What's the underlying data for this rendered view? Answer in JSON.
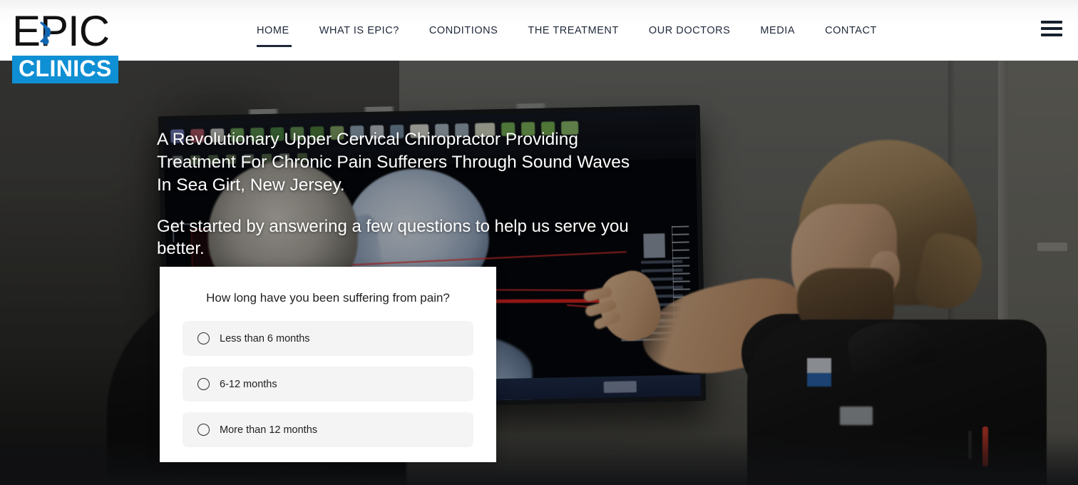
{
  "brand": {
    "name_top": "EPIC",
    "name_bottom": "CLINICS",
    "accent_blue": "#0f8fd4",
    "nav_color": "#1e2838"
  },
  "header": {
    "nav": [
      {
        "label": "HOME",
        "active": true
      },
      {
        "label": "WHAT IS EPIC?",
        "active": false
      },
      {
        "label": "CONDITIONS",
        "active": false
      },
      {
        "label": "THE TREATMENT",
        "active": false
      },
      {
        "label": "OUR DOCTORS",
        "active": false
      },
      {
        "label": "MEDIA",
        "active": false
      },
      {
        "label": "CONTACT",
        "active": false
      }
    ],
    "menu_icon": "hamburger-icon"
  },
  "hero": {
    "headline": "A Revolutionary Upper Cervical Chiropractor Providing Treatment For Chronic Pain Sufferers Through Sound Waves In Sea Girt, New Jersey.",
    "subheadline": "Get started by answering a few questions to help us serve you better."
  },
  "quiz": {
    "question": "How long have you been suffering from pain?",
    "options": [
      {
        "label": "Less than 6 months",
        "selected": false
      },
      {
        "label": "6-12 months",
        "selected": false
      },
      {
        "label": "More than 12 months",
        "selected": false
      }
    ]
  }
}
